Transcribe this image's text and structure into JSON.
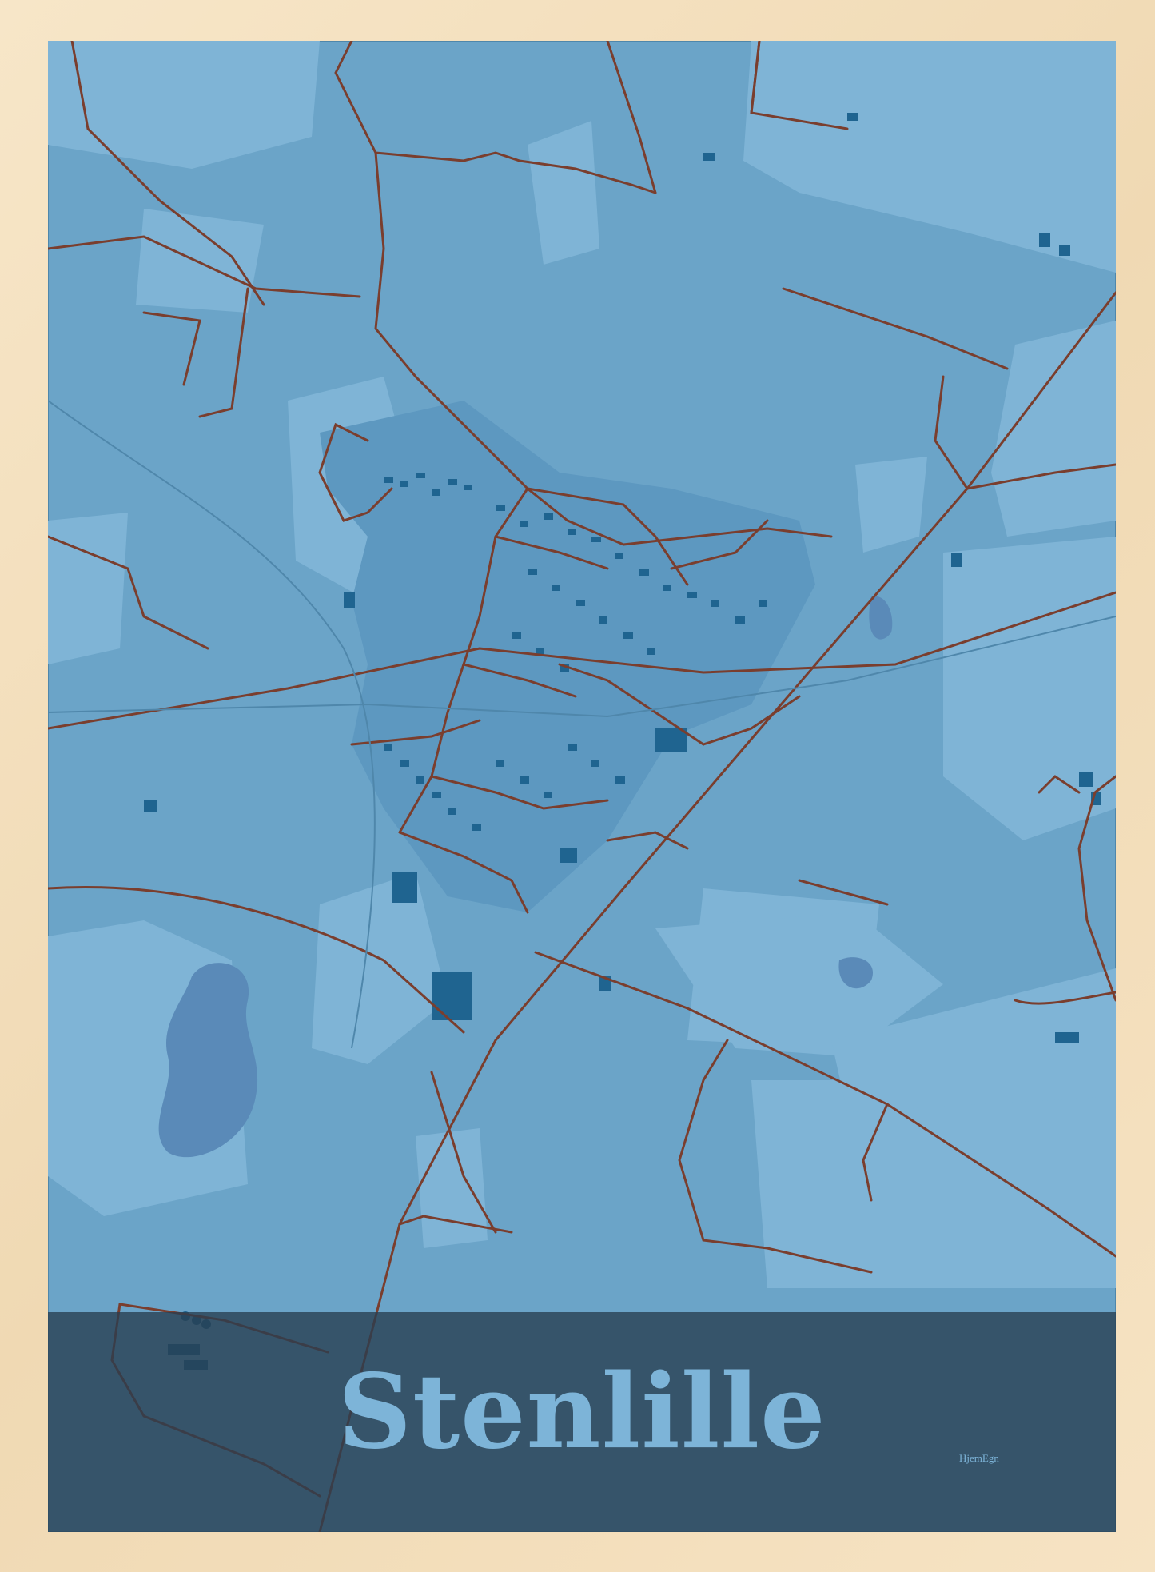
{
  "poster": {
    "title": "Stenlille",
    "brand": "HjemEgn"
  },
  "colors": {
    "frame": "#f3dfbf",
    "map_base": "#6ba4c8",
    "map_light": "#7fb4d6",
    "water": "#5a8ab8",
    "buildings": "#1f6490",
    "roads": "#7a3e2e",
    "banner": "#2e4a5e",
    "title_text": "#7db4d8"
  }
}
